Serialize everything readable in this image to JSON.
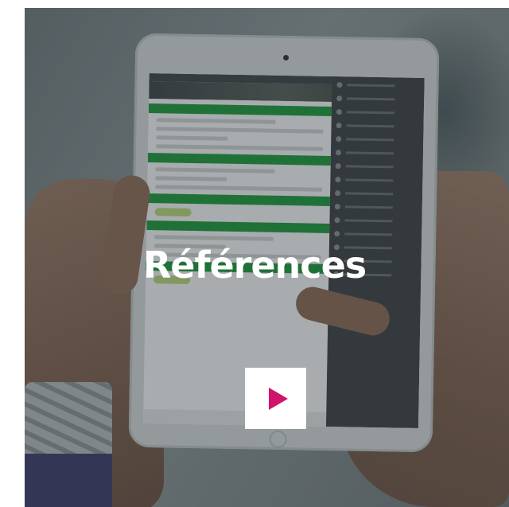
{
  "title": "Références",
  "play_button": {
    "icon": "play-icon",
    "color": "#d0136b"
  },
  "accent_green": "#1c9a3a"
}
